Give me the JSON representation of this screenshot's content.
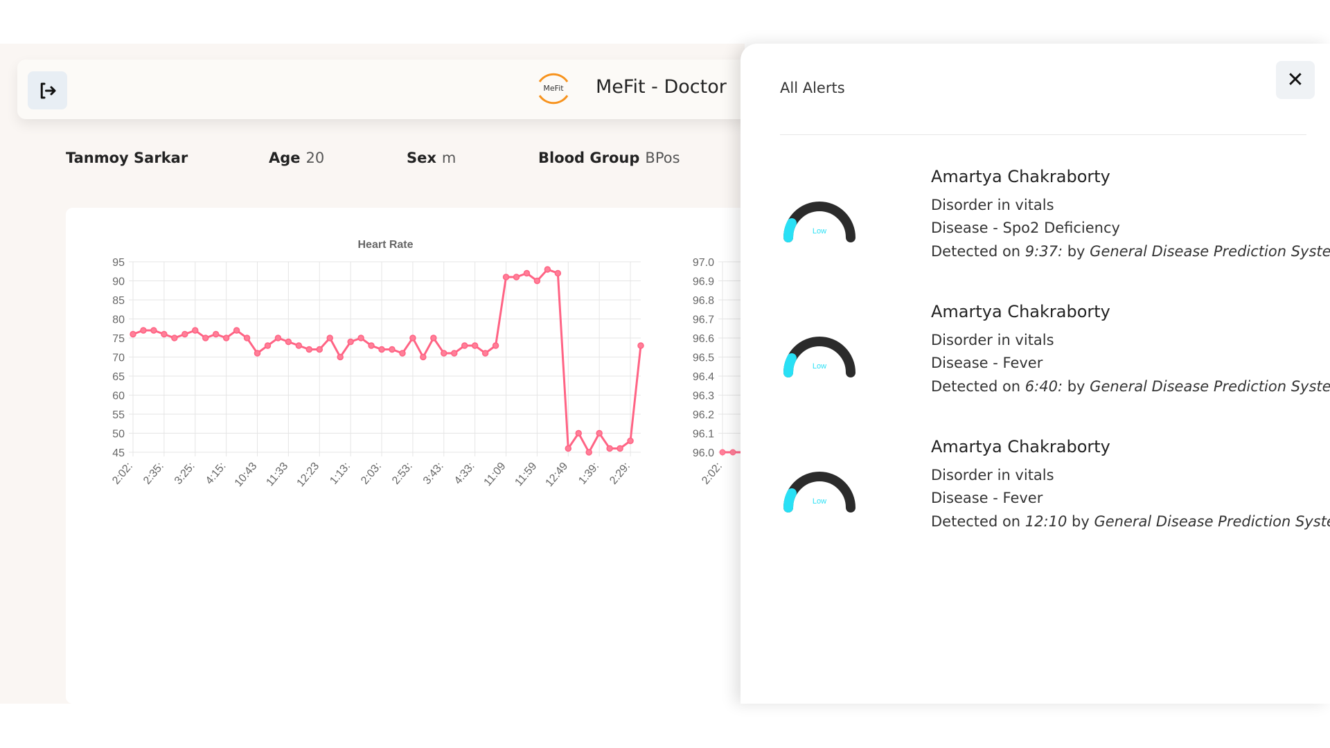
{
  "header": {
    "title": "MeFit - Doctor",
    "logo_text": "MeFit",
    "logout_icon": "logout-icon"
  },
  "patient": {
    "name": "Tanmoy Sarkar",
    "age_label": "Age",
    "age": "20",
    "sex_label": "Sex",
    "sex": "m",
    "blood_label": "Blood Group",
    "blood": "BPos"
  },
  "chart_data": [
    {
      "type": "line",
      "title": "Heart Rate",
      "ylim": [
        45,
        95
      ],
      "yticks": [
        95,
        90,
        85,
        80,
        75,
        70,
        65,
        60,
        55,
        50,
        45
      ],
      "grid": true,
      "color": "#ff6384",
      "xtick_labels": [
        "2:02:",
        "2:35:",
        "3:25:",
        "4:15:",
        "10:43",
        "11:33",
        "12:23",
        "1:13:",
        "2:03:",
        "2:53:",
        "3:43:",
        "4:33:",
        "11:09",
        "11:59",
        "12:49",
        "1:39:",
        "2:29:"
      ],
      "values": [
        76,
        77,
        77,
        76,
        75,
        76,
        77,
        75,
        76,
        75,
        77,
        75,
        71,
        73,
        75,
        74,
        73,
        72,
        72,
        75,
        70,
        74,
        75,
        73,
        72,
        72,
        71,
        75,
        70,
        75,
        71,
        71,
        73,
        73,
        71,
        73,
        91,
        91,
        92,
        90,
        93,
        92,
        46,
        50,
        45,
        50,
        46,
        46,
        48,
        73
      ]
    },
    {
      "type": "line",
      "ylim": [
        96.0,
        97.0
      ],
      "yticks": [
        "97.0",
        "96.9",
        "96.8",
        "96.7",
        "96.6",
        "96.5",
        "96.4",
        "96.3",
        "96.2",
        "96.1",
        "96.0"
      ],
      "grid": true,
      "color": "#ff6384",
      "xtick_labels": [
        "2:02:"
      ],
      "values": [
        96.0,
        96.0,
        96.0
      ]
    }
  ],
  "alerts_panel": {
    "title": "All Alerts",
    "close_icon": "close-icon",
    "items": [
      {
        "name": "Amartya Chakraborty",
        "line1": "Disorder in vitals",
        "line2": "Disease - Spo2 Deficiency",
        "detected_prefix": "Detected on",
        "time": "9:37:",
        "by": "by",
        "system": "General Disease Prediction System",
        "gauge_label": "Low",
        "gauge_level": 0.15
      },
      {
        "name": "Amartya Chakraborty",
        "line1": "Disorder in vitals",
        "line2": "Disease - Fever",
        "detected_prefix": "Detected on",
        "time": "6:40:",
        "by": "by",
        "system": "General Disease Prediction System",
        "gauge_label": "Low",
        "gauge_level": 0.15
      },
      {
        "name": "Amartya Chakraborty",
        "line1": "Disorder in vitals",
        "line2": "Disease - Fever",
        "detected_prefix": "Detected on",
        "time": "12:10",
        "by": "by",
        "system": "General Disease Prediction System",
        "gauge_label": "Low",
        "gauge_level": 0.15
      }
    ]
  },
  "colors": {
    "accent": "#ff6384",
    "logo": "#f7931e",
    "gauge_fill": "#29e0f5",
    "gauge_track": "#2b2b2b"
  }
}
